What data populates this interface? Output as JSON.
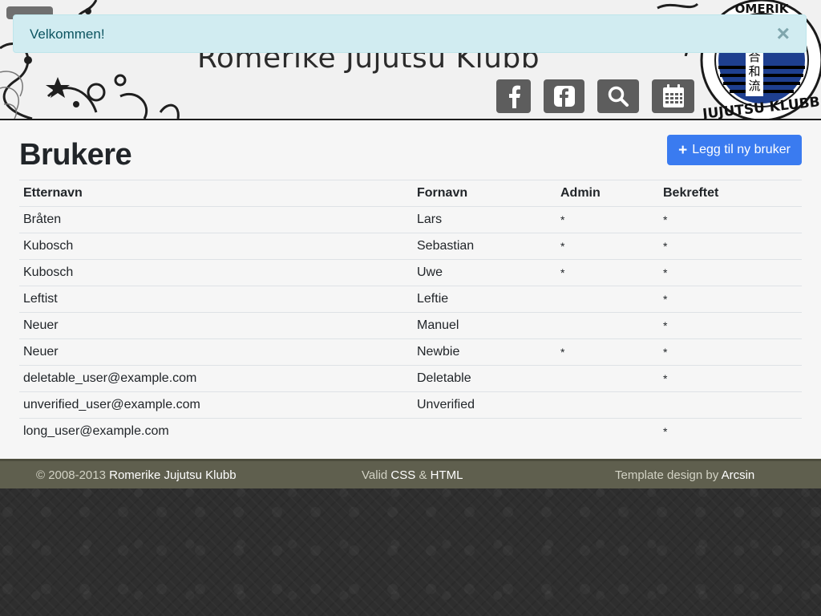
{
  "header": {
    "site_title": "Romerike Jujutsu Klubb",
    "icons": [
      "facebook-icon",
      "facebook-square-icon",
      "search-icon",
      "calendar-icon"
    ]
  },
  "alert": {
    "message": "Velkommen!",
    "close": "×",
    "bg_color": "#d1ecf1",
    "text_color": "#0c5460"
  },
  "main": {
    "title": "Brukere",
    "add_button": {
      "icon": "+",
      "label": "Legg til ny bruker",
      "color": "#3a7bf0"
    }
  },
  "table": {
    "columns": [
      "Etternavn",
      "Fornavn",
      "Admin",
      "Bekreftet"
    ],
    "rows": [
      {
        "last": "Bråten",
        "first": "Lars",
        "admin": "*",
        "confirmed": "*"
      },
      {
        "last": "Kubosch",
        "first": "Sebastian",
        "admin": "*",
        "confirmed": "*"
      },
      {
        "last": "Kubosch",
        "first": "Uwe",
        "admin": "*",
        "confirmed": "*"
      },
      {
        "last": "Leftist",
        "first": "Leftie",
        "admin": "",
        "confirmed": "*"
      },
      {
        "last": "Neuer",
        "first": "Manuel",
        "admin": "",
        "confirmed": "*"
      },
      {
        "last": "Neuer",
        "first": "Newbie",
        "admin": "*",
        "confirmed": "*"
      },
      {
        "last": "deletable_user@example.com",
        "first": "Deletable",
        "admin": "",
        "confirmed": "*"
      },
      {
        "last": "unverified_user@example.com",
        "first": "Unverified",
        "admin": "",
        "confirmed": ""
      },
      {
        "last": "long_user@example.com",
        "first": "",
        "admin": "",
        "confirmed": "*"
      }
    ]
  },
  "footer": {
    "copyright_prefix": "© 2008-2013",
    "club_name": "Romerike Jujutsu Klubb",
    "valid_prefix": "Valid",
    "css_link": "CSS",
    "amp": "&",
    "html_link": "HTML",
    "design_prefix": "Template design by",
    "designer": "Arcsin",
    "bg_color": "#5f5f4e"
  }
}
